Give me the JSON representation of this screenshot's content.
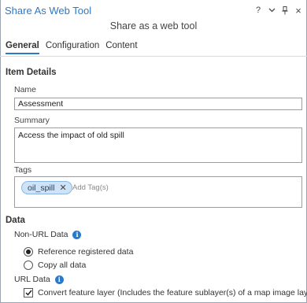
{
  "window": {
    "title": "Share As Web Tool",
    "subtitle": "Share as a web tool"
  },
  "titlebar_controls": {
    "help": "?",
    "menu": "chevron-down-icon",
    "pin": "pin-icon",
    "close": "×"
  },
  "tabs": [
    {
      "label": "General",
      "active": true
    },
    {
      "label": "Configuration",
      "active": false
    },
    {
      "label": "Content",
      "active": false
    }
  ],
  "item_details": {
    "heading": "Item Details",
    "name_label": "Name",
    "name_value": "Assessment",
    "summary_label": "Summary",
    "summary_value": "Access the impact of old spill",
    "tags_label": "Tags",
    "tags": [
      "oil_spill"
    ],
    "tag_remove": "✕",
    "tags_placeholder": "Add Tag(s)"
  },
  "data": {
    "heading": "Data",
    "non_url_label": "Non-URL Data",
    "option_reference": "Reference registered data",
    "option_copy": "Copy all data",
    "selected_option": "Reference registered data",
    "url_label": "URL Data",
    "convert_label": "Convert feature layer (Includes the feature sublayer(s) of a map image layer)",
    "convert_checked": true,
    "info_glyph": "i"
  },
  "colors": {
    "accent": "#2b79c9",
    "tag_bg": "#cfe3f7"
  }
}
